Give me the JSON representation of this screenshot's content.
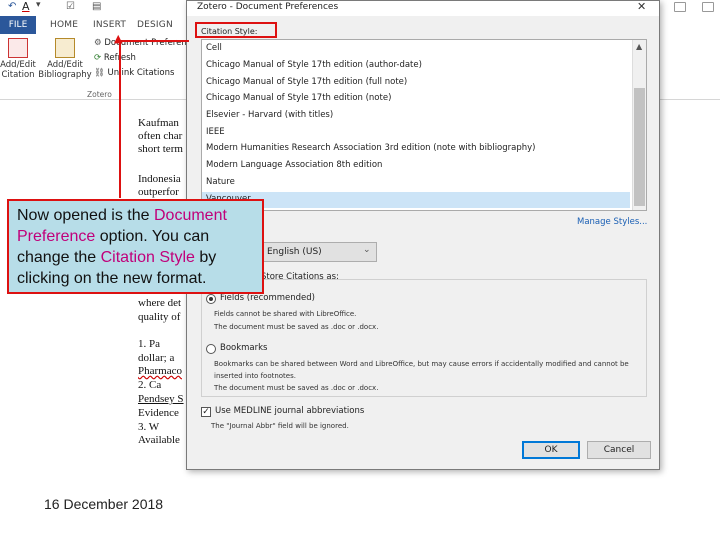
{
  "word": {
    "tabs": {
      "file": "FILE",
      "home": "HOME",
      "insert": "INSERT",
      "design": "DESIGN"
    },
    "ribbon": {
      "add_edit_citation": [
        "Add/Edit",
        "Citation"
      ],
      "add_edit_bibliography": [
        "Add/Edit",
        "Bibliography"
      ],
      "document_preferences": "Document Preferen",
      "refresh": "Refresh",
      "unlink": "Unlink Citations",
      "group": "Zotero"
    },
    "doc_lines": [
      "Kaufman",
      "often char",
      "short term",
      "Indonesia",
      "outperfor",
      "where det",
      "quality of",
      "1.      Pa",
      "dollar; a",
      "Pharmaco",
      "2.      Ca",
      "Pendsey S",
      "Evidence",
      "3.      W",
      "Available"
    ]
  },
  "dialog": {
    "title": "Zotero - Document Preferences",
    "close": "✕",
    "citation_style_label": "Citation Style:",
    "styles": [
      "Cell",
      "Chicago Manual of Style 17th edition (author-date)",
      "Chicago Manual of Style 17th edition (full note)",
      "Chicago Manual of Style 17th edition (note)",
      "Elsevier - Harvard (with titles)",
      "IEEE",
      "Modern Humanities Research Association 3rd edition (note with bibliography)",
      "Modern Language Association 8th edition",
      "Nature",
      "Vancouver"
    ],
    "selected_index": 9,
    "manage_styles": "Manage Styles...",
    "language_value": "English (US)",
    "format_label": "Store Citations as:",
    "fields_title": "Fields (recommended)",
    "fields_desc1": "Fields cannot be shared with LibreOffice.",
    "fields_desc2": "The document must be saved as .doc or .docx.",
    "bookmarks_title": "Bookmarks",
    "bookmarks_desc1": "Bookmarks can be shared between Word and LibreOffice, but may cause errors if accidentally modified and cannot be",
    "bookmarks_desc2": "inserted into footnotes.",
    "bookmarks_desc3": "The document must be saved as .doc or .docx.",
    "medline_label": "Use MEDLINE journal abbreviations",
    "medline_sub": "The \"Journal Abbr\" field will be ignored.",
    "ok": "OK",
    "cancel": "Cancel"
  },
  "callout": {
    "p1": "Now opened is the ",
    "p2": "Document Preference",
    "p3": " option. You can change the ",
    "p4": "Citation Style",
    "p5": " by clicking on the new format."
  },
  "footer_date": "16 December 2018",
  "colors": {
    "annotation": "#dd1111",
    "callout_bg": "#b7dde8",
    "highlight": "#c0007a",
    "file_tab": "#2b579a"
  }
}
